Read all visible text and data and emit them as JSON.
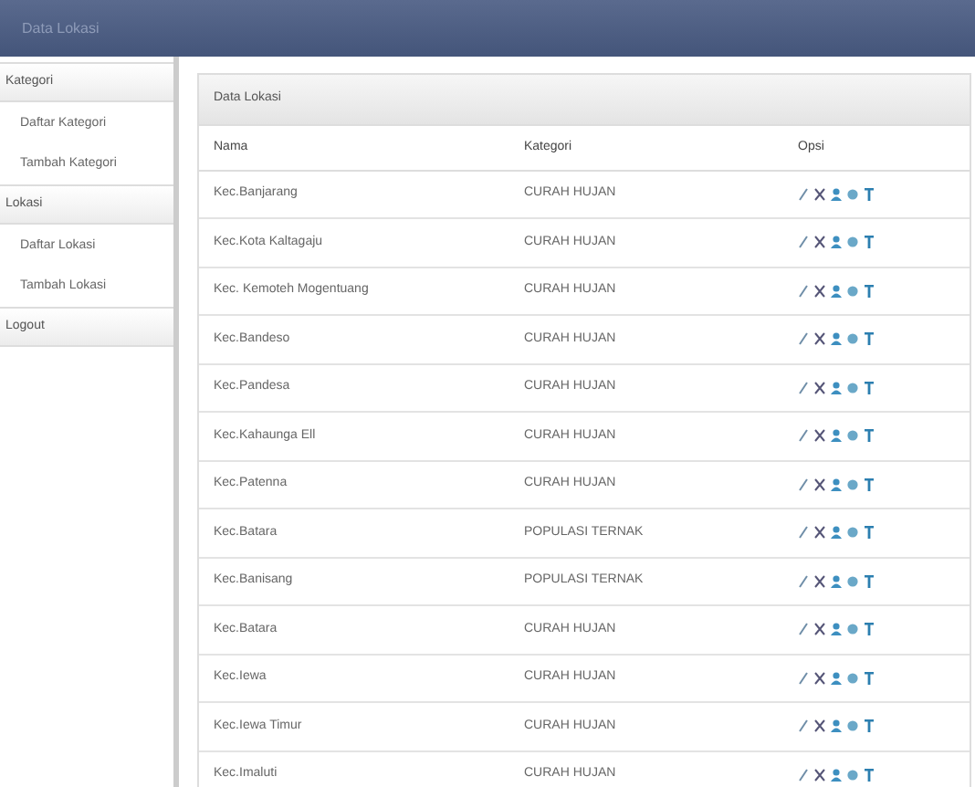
{
  "header": {
    "title": "Data Lokasi"
  },
  "sidebar": {
    "sections": [
      {
        "title": "Kategori",
        "items": [
          {
            "label": "Daftar Kategori"
          },
          {
            "label": "Tambah Kategori"
          }
        ]
      },
      {
        "title": "Lokasi",
        "items": [
          {
            "label": "Daftar Lokasi"
          },
          {
            "label": "Tambah Lokasi"
          }
        ]
      },
      {
        "title": "Logout"
      }
    ]
  },
  "panel": {
    "title": "Data Lokasi",
    "columns": [
      "Nama",
      "Kategori",
      "Opsi"
    ],
    "rows": [
      {
        "name": "Kec.Banjarang",
        "category": "CURAH HUJAN"
      },
      {
        "name": "Kec.Kota Kaltagaju",
        "category": "CURAH HUJAN"
      },
      {
        "name": "Kec. Kemoteh Mogentuang",
        "category": "CURAH HUJAN"
      },
      {
        "name": "Kec.Bandeso",
        "category": "CURAH HUJAN"
      },
      {
        "name": "Kec.Pandesa",
        "category": "CURAH HUJAN"
      },
      {
        "name": "Kec.Kahaunga Ell",
        "category": "CURAH HUJAN"
      },
      {
        "name": "Kec.Patenna",
        "category": "CURAH HUJAN"
      },
      {
        "name": "Kec.Batara",
        "category": "POPULASI TERNAK"
      },
      {
        "name": "Kec.Banisang",
        "category": "POPULASI TERNAK"
      },
      {
        "name": "Kec.Batara",
        "category": "CURAH HUJAN"
      },
      {
        "name": "Kec.Iewa",
        "category": "CURAH HUJAN"
      },
      {
        "name": "Kec.Iewa Timur",
        "category": "CURAH HUJAN"
      },
      {
        "name": "Kec.Imaluti",
        "category": "CURAH HUJAN"
      }
    ]
  }
}
